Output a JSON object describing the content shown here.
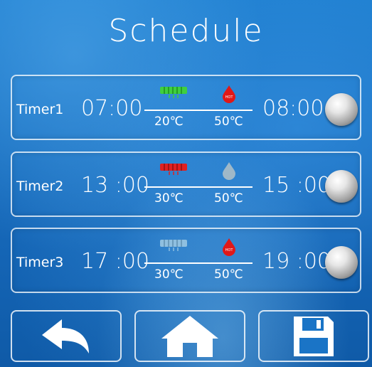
{
  "title": "Schedule",
  "timers": [
    {
      "label": "Timer1",
      "start": "07:00",
      "end": "08:00",
      "cool_temp": "20℃",
      "hot_temp": "50℃",
      "heat_icon_color": "#3fcf3f",
      "drop_icon_color": "#e01818",
      "enabled_indicator": "circle-toggle"
    },
    {
      "label": "Timer2",
      "start": "13 :00",
      "end": "15 :00",
      "cool_temp": "30℃",
      "hot_temp": "50℃",
      "heat_icon_color": "#e02020",
      "drop_icon_color": "#9fb8c8",
      "enabled_indicator": "circle-toggle"
    },
    {
      "label": "Timer3",
      "start": "17 :00",
      "end": "19 :00",
      "cool_temp": "30℃",
      "hot_temp": "50℃",
      "heat_icon_color": "#8fbfe0",
      "drop_icon_color": "#e01818",
      "enabled_indicator": "circle-toggle"
    }
  ],
  "nav": [
    {
      "icon": "back-arrow-icon"
    },
    {
      "icon": "home-icon"
    },
    {
      "icon": "save-floppy-icon"
    }
  ],
  "colors": {
    "background": "#1a74c6",
    "text": "#ffffff"
  }
}
